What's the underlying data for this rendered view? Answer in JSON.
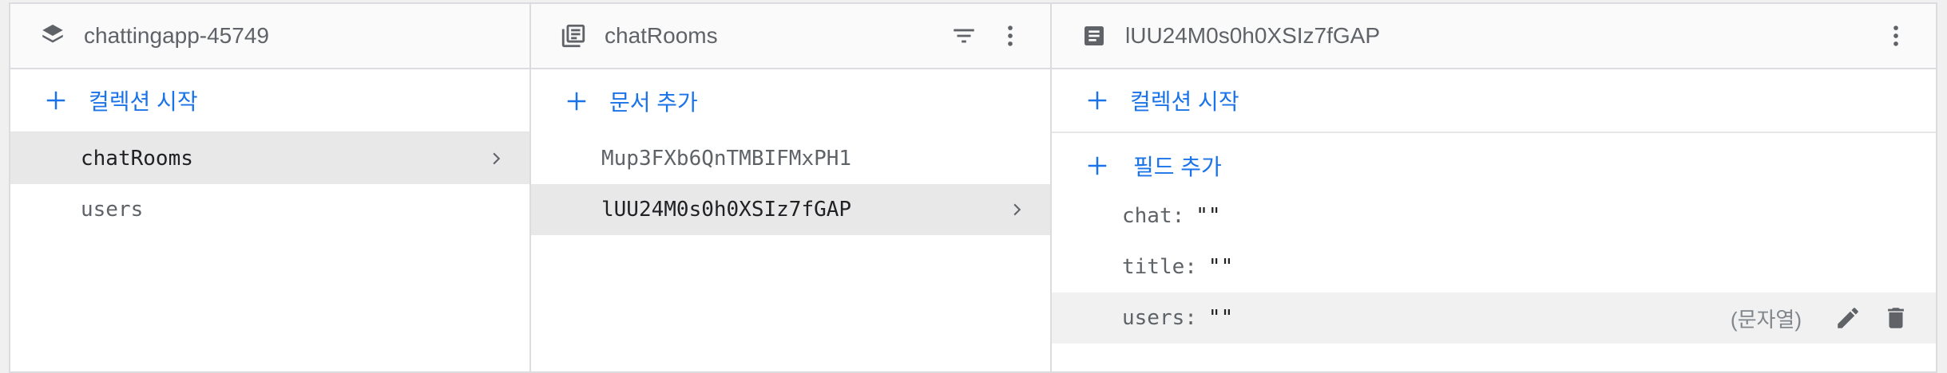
{
  "colors": {
    "accent": "#1a73e8",
    "icon_gray": "#5f6368",
    "selected_bg": "#e8e8e8"
  },
  "panel1": {
    "title": "chattingapp-45749",
    "icon": "database-stack-icon",
    "action_label": "컬렉션 시작",
    "items": [
      {
        "label": "chatRooms",
        "selected": true
      },
      {
        "label": "users",
        "selected": false
      }
    ]
  },
  "panel2": {
    "title": "chatRooms",
    "icon": "collection-icon",
    "action_label": "문서 추가",
    "items": [
      {
        "label": "Mup3FXb6QnTMBIFMxPH1",
        "selected": false
      },
      {
        "label": "lUU24M0s0h0XSIz7fGAP",
        "selected": true
      }
    ]
  },
  "panel3": {
    "title": "lUU24M0s0h0XSIz7fGAP",
    "icon": "document-icon",
    "action_label": "컬렉션 시작",
    "add_field_label": "필드 추가",
    "fields": [
      {
        "key": "chat:",
        "value": "\"\""
      },
      {
        "key": "title:",
        "value": "\"\""
      },
      {
        "key": "users:",
        "value": "\"\"",
        "type": "(문자열)"
      }
    ]
  }
}
